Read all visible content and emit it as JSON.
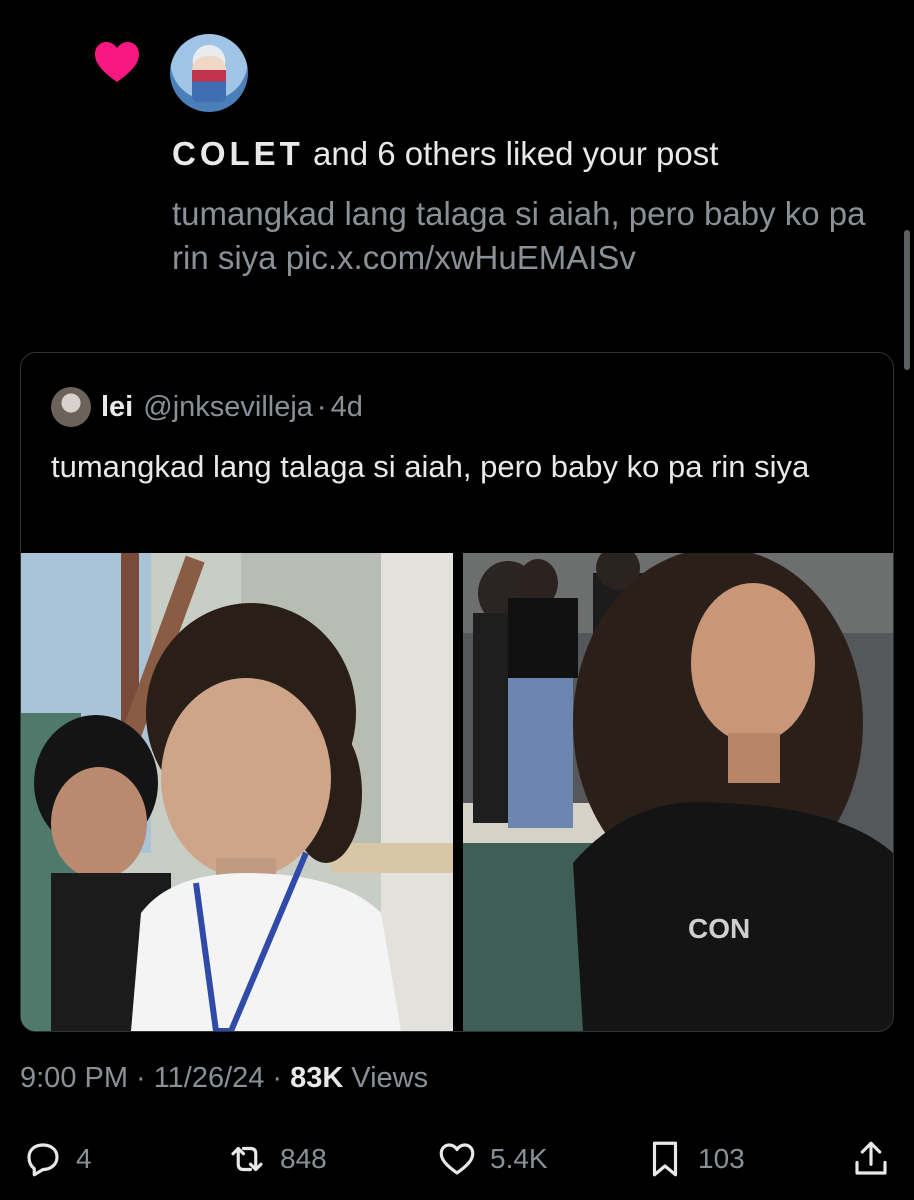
{
  "notification": {
    "actor": "COLET",
    "action_text": "and 6 others liked your post",
    "post_preview": "tumangkad lang talaga si aiah, pero baby ko pa rin siya pic.x.com/xwHuEMAISv",
    "icon": "heart-icon",
    "accent_color": "#f91880"
  },
  "quoted_post": {
    "display_name": "lei",
    "handle": "@jnksevilleja",
    "dot": "·",
    "time": "4d",
    "text": "tumangkad lang talaga si aiah, pero baby ko pa rin siya",
    "images": [
      "photo-left",
      "photo-right"
    ],
    "shirt_text": "CON"
  },
  "meta": {
    "time": "9:00 PM",
    "date": "11/26/24",
    "sep1": "·",
    "sep2": "·",
    "views_count": "83K",
    "views_label": "Views"
  },
  "actions": {
    "replies": "4",
    "reposts": "848",
    "likes": "5.4K",
    "bookmarks": "103"
  },
  "colors": {
    "background": "#000000",
    "text_primary": "#e7e9ea",
    "text_secondary": "#8b9096",
    "border": "#2f3336"
  }
}
